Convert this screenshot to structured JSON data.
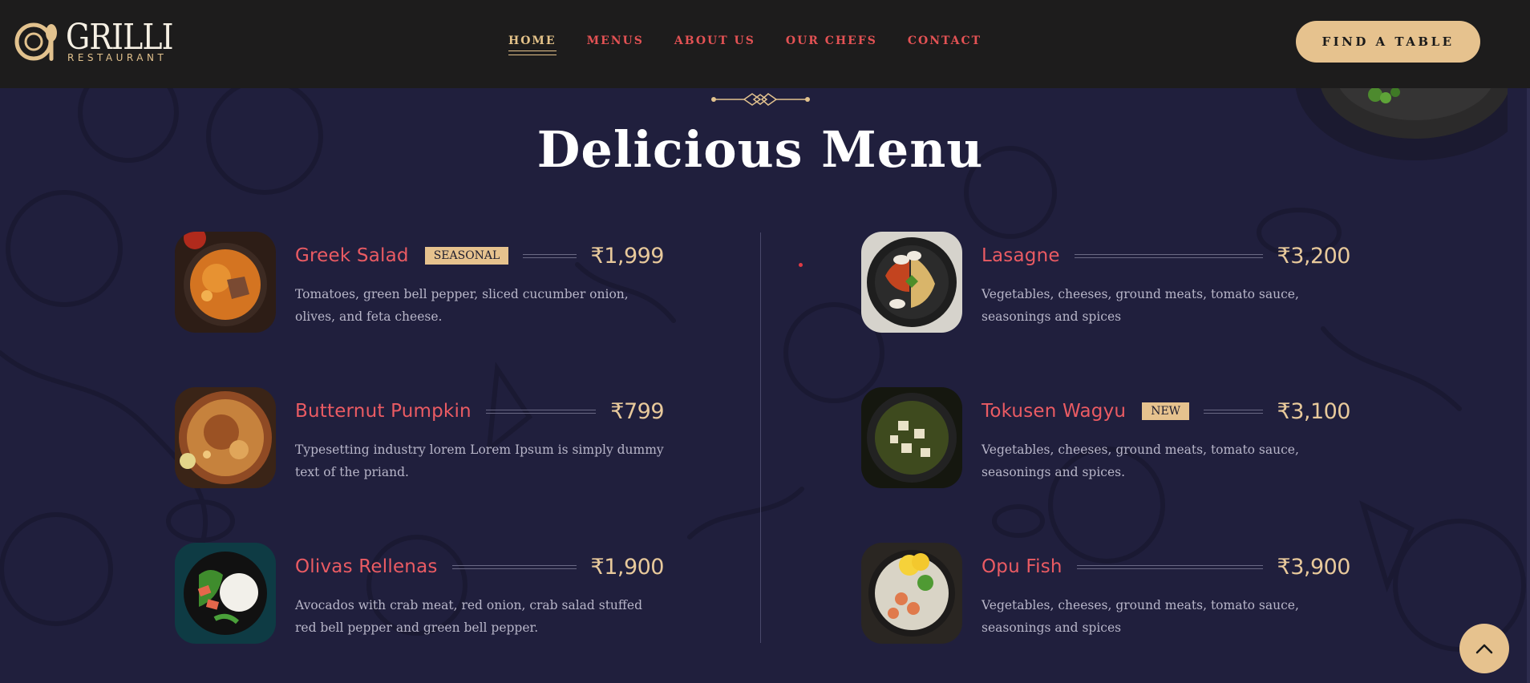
{
  "header": {
    "logo_word": "GRILLI",
    "logo_sub": "RESTAURANT",
    "nav": [
      {
        "label": "HOME",
        "active": true
      },
      {
        "label": "MENUS",
        "active": false
      },
      {
        "label": "ABOUT US",
        "active": false
      },
      {
        "label": "OUR CHEFS",
        "active": false
      },
      {
        "label": "CONTACT",
        "active": false
      }
    ],
    "cta_label": "FIND A TABLE"
  },
  "section": {
    "title": "Delicious Menu"
  },
  "menu_items": [
    {
      "name": "Greek Salad",
      "tag": "SEASONAL",
      "price": "₹1,999",
      "description": "Tomatoes, green bell pepper, sliced cucumber onion, olives, and feta cheese.",
      "image_icon": "curry-bowl-photo"
    },
    {
      "name": "Lasagne",
      "tag": "",
      "price": "₹3,200",
      "description": "Vegetables, cheeses, ground meats, tomato sauce, seasonings and spices",
      "image_icon": "noodle-platter-photo"
    },
    {
      "name": "Butternut Pumpkin",
      "tag": "",
      "price": "₹799",
      "description": "Typesetting industry lorem Lorem Ipsum is simply dummy text of the priand.",
      "image_icon": "biryani-bowl-photo"
    },
    {
      "name": "Tokusen Wagyu",
      "tag": "NEW",
      "price": "₹3,100",
      "description": "Vegetables, cheeses, ground meats, tomato sauce, seasonings and spices.",
      "image_icon": "palak-paneer-photo"
    },
    {
      "name": "Olivas Rellenas",
      "tag": "",
      "price": "₹1,900",
      "description": "Avocados with crab meat, red onion, crab salad stuffed red bell pepper and green bell pepper.",
      "image_icon": "rice-plate-photo"
    },
    {
      "name": "Opu Fish",
      "tag": "",
      "price": "₹3,900",
      "description": "Vegetables, cheeses, ground meats, tomato sauce, seasonings and spices",
      "image_icon": "shrimp-rice-photo"
    }
  ],
  "colors": {
    "background": "#201f3d",
    "header": "#1d1c1c",
    "accent_gold": "#e6c28e",
    "accent_red": "#ea5b63"
  }
}
